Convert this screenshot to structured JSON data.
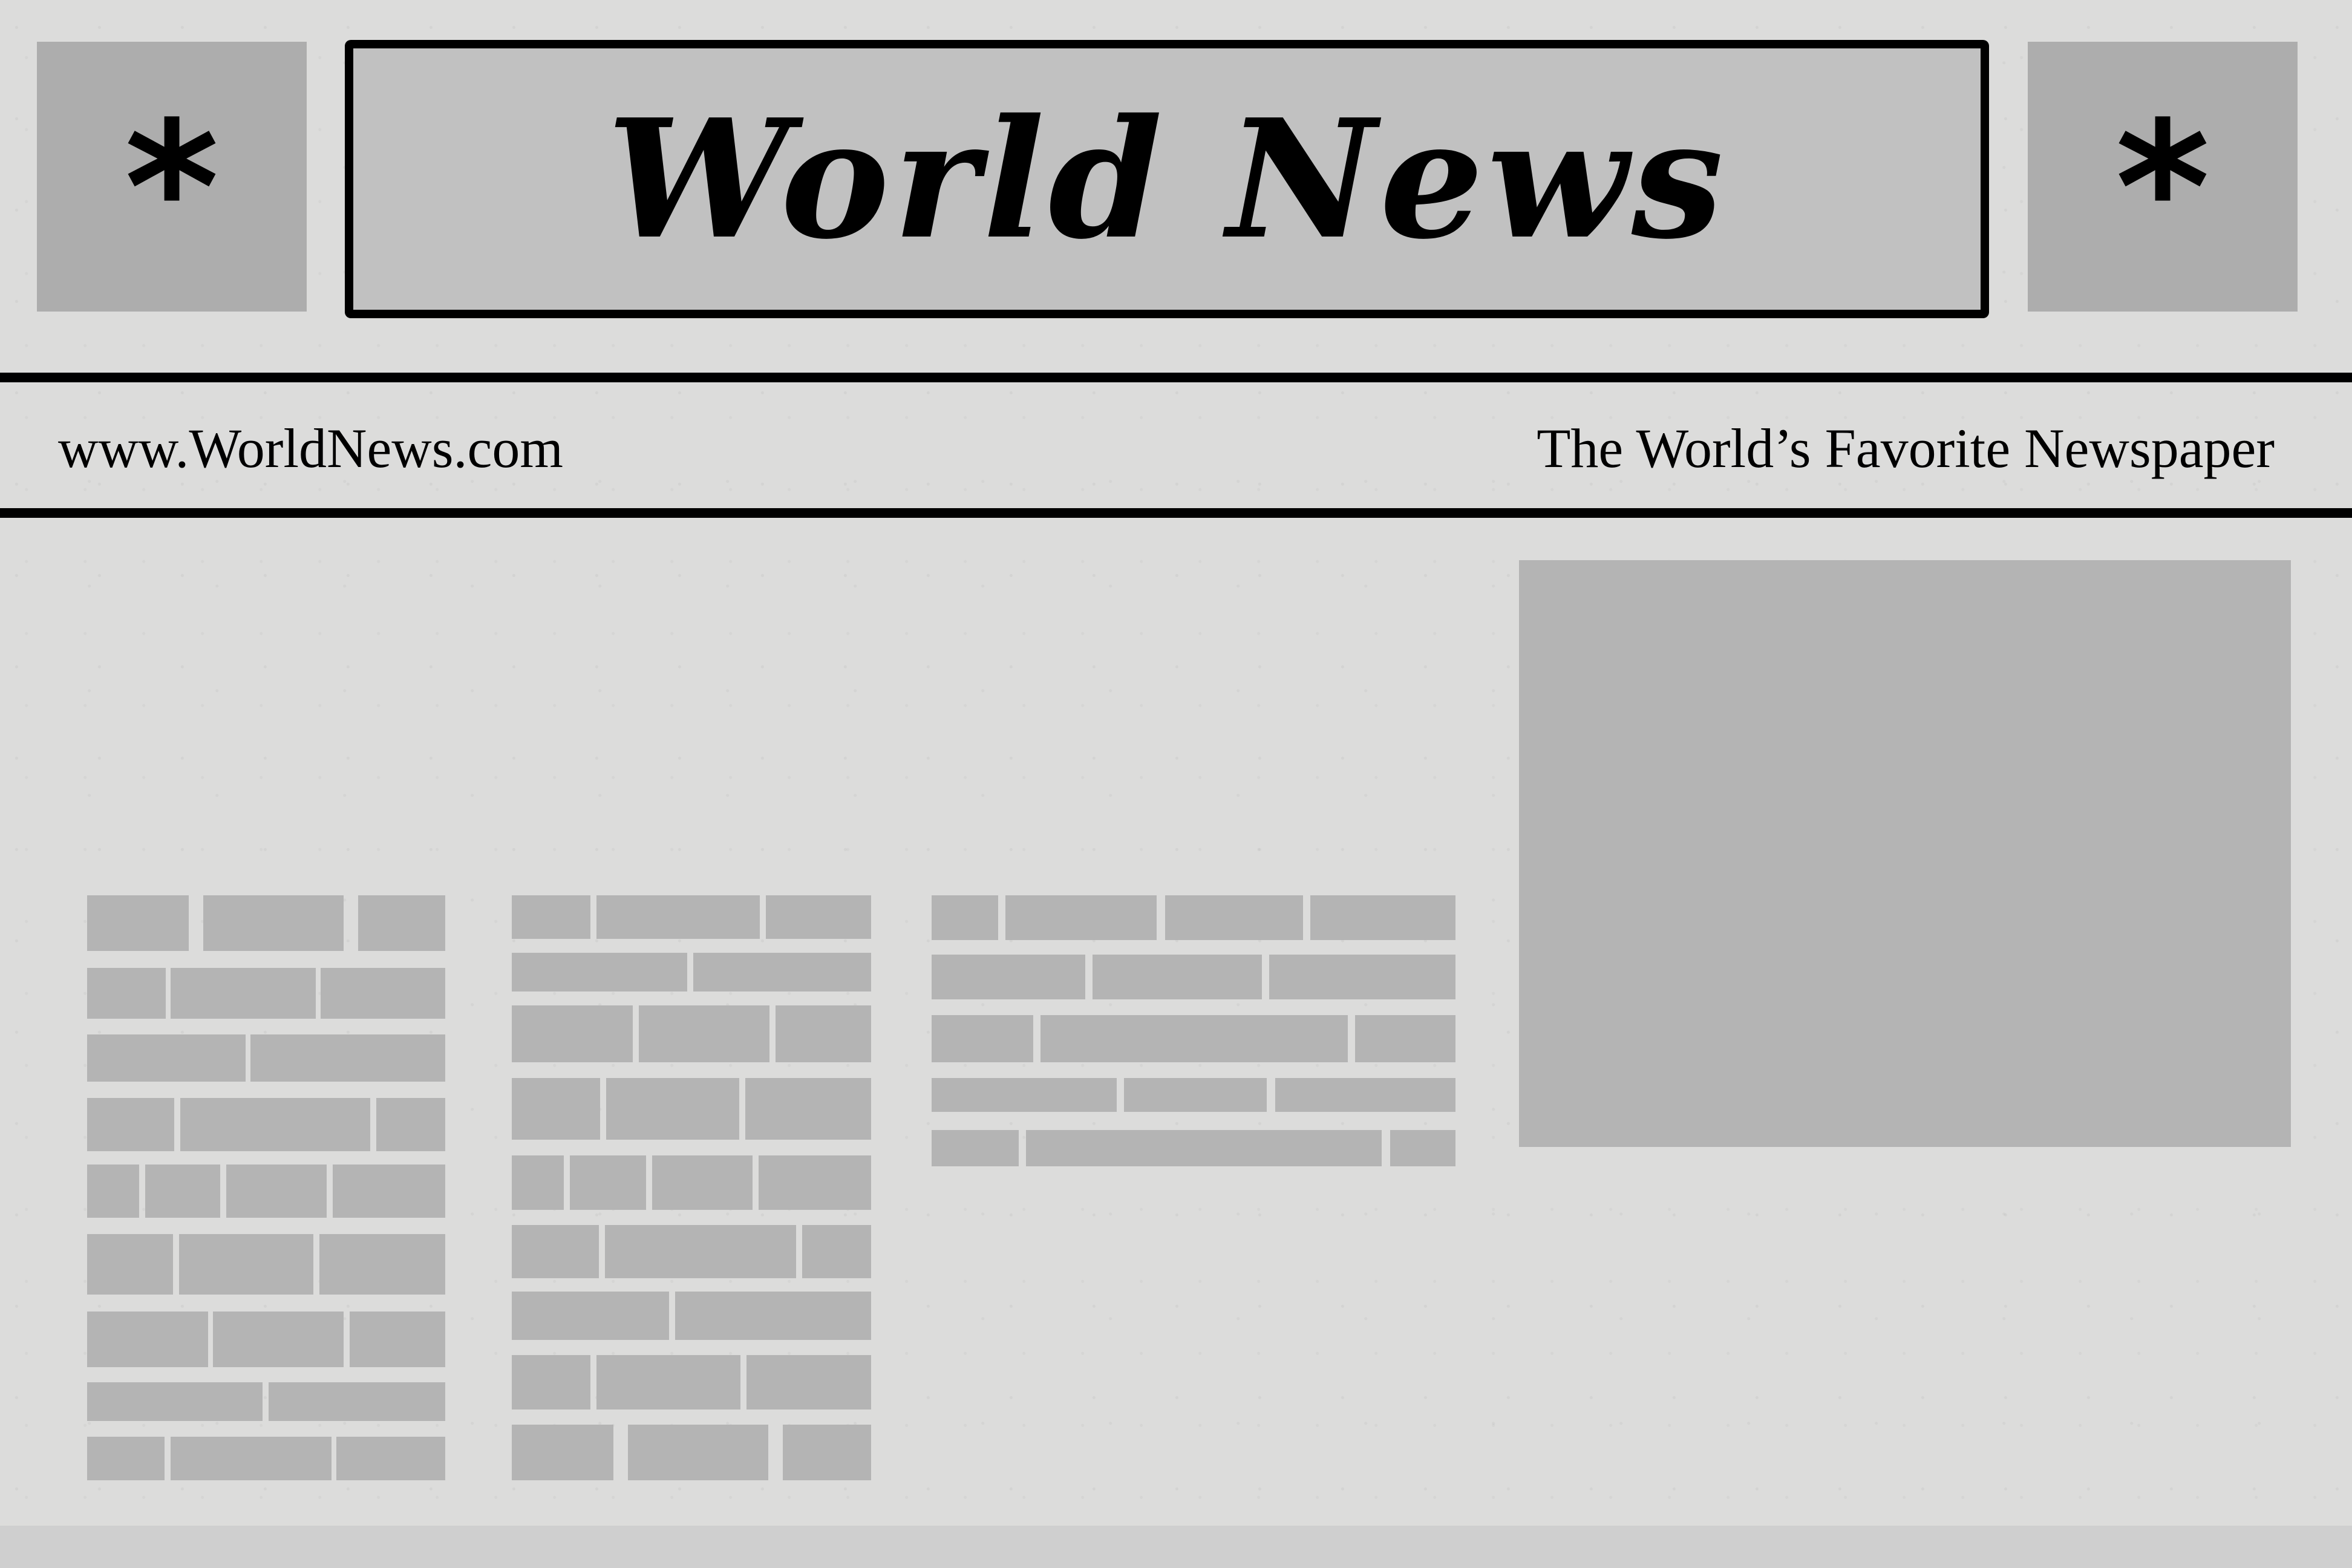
{
  "masthead": {
    "title": "World News",
    "left_ornament": "*",
    "right_ornament": "*"
  },
  "subheader": {
    "website": "www.WorldNews.com",
    "tagline": "The World’s Favorite Newspaper"
  },
  "colors": {
    "page": "#dcdcdb",
    "ornament_box": "#adadad",
    "title_box": "#c1c1c1",
    "placeholder": "#b4b4b4",
    "ink": "#000000"
  },
  "placeholders": {
    "photo": "image-placeholder",
    "text_columns": [
      "text-column-1",
      "text-column-2",
      "text-column-3"
    ]
  }
}
